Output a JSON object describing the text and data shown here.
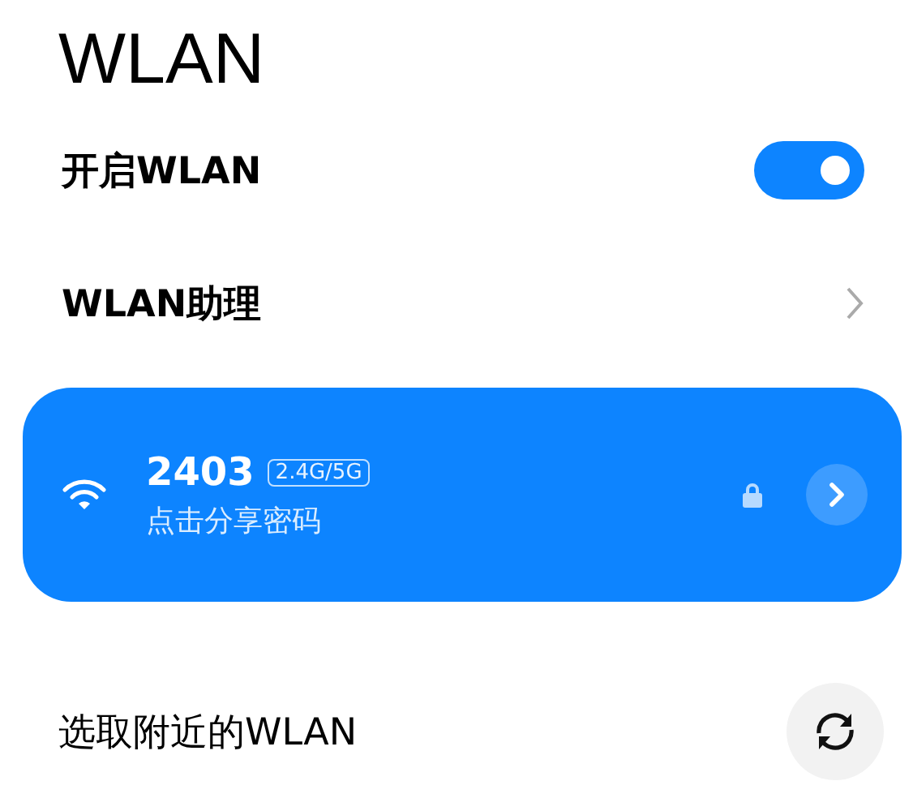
{
  "title": "WLAN",
  "rows": [
    {
      "kind": "toggle",
      "label": "开启WLAN",
      "on": true
    },
    {
      "kind": "link",
      "label": "WLAN助理"
    }
  ],
  "connected": {
    "name": "2403",
    "band": "2.4G/5G",
    "subtitle": "点击分享密码",
    "locked": true
  },
  "nearby": {
    "label": "选取附近的WLAN"
  }
}
